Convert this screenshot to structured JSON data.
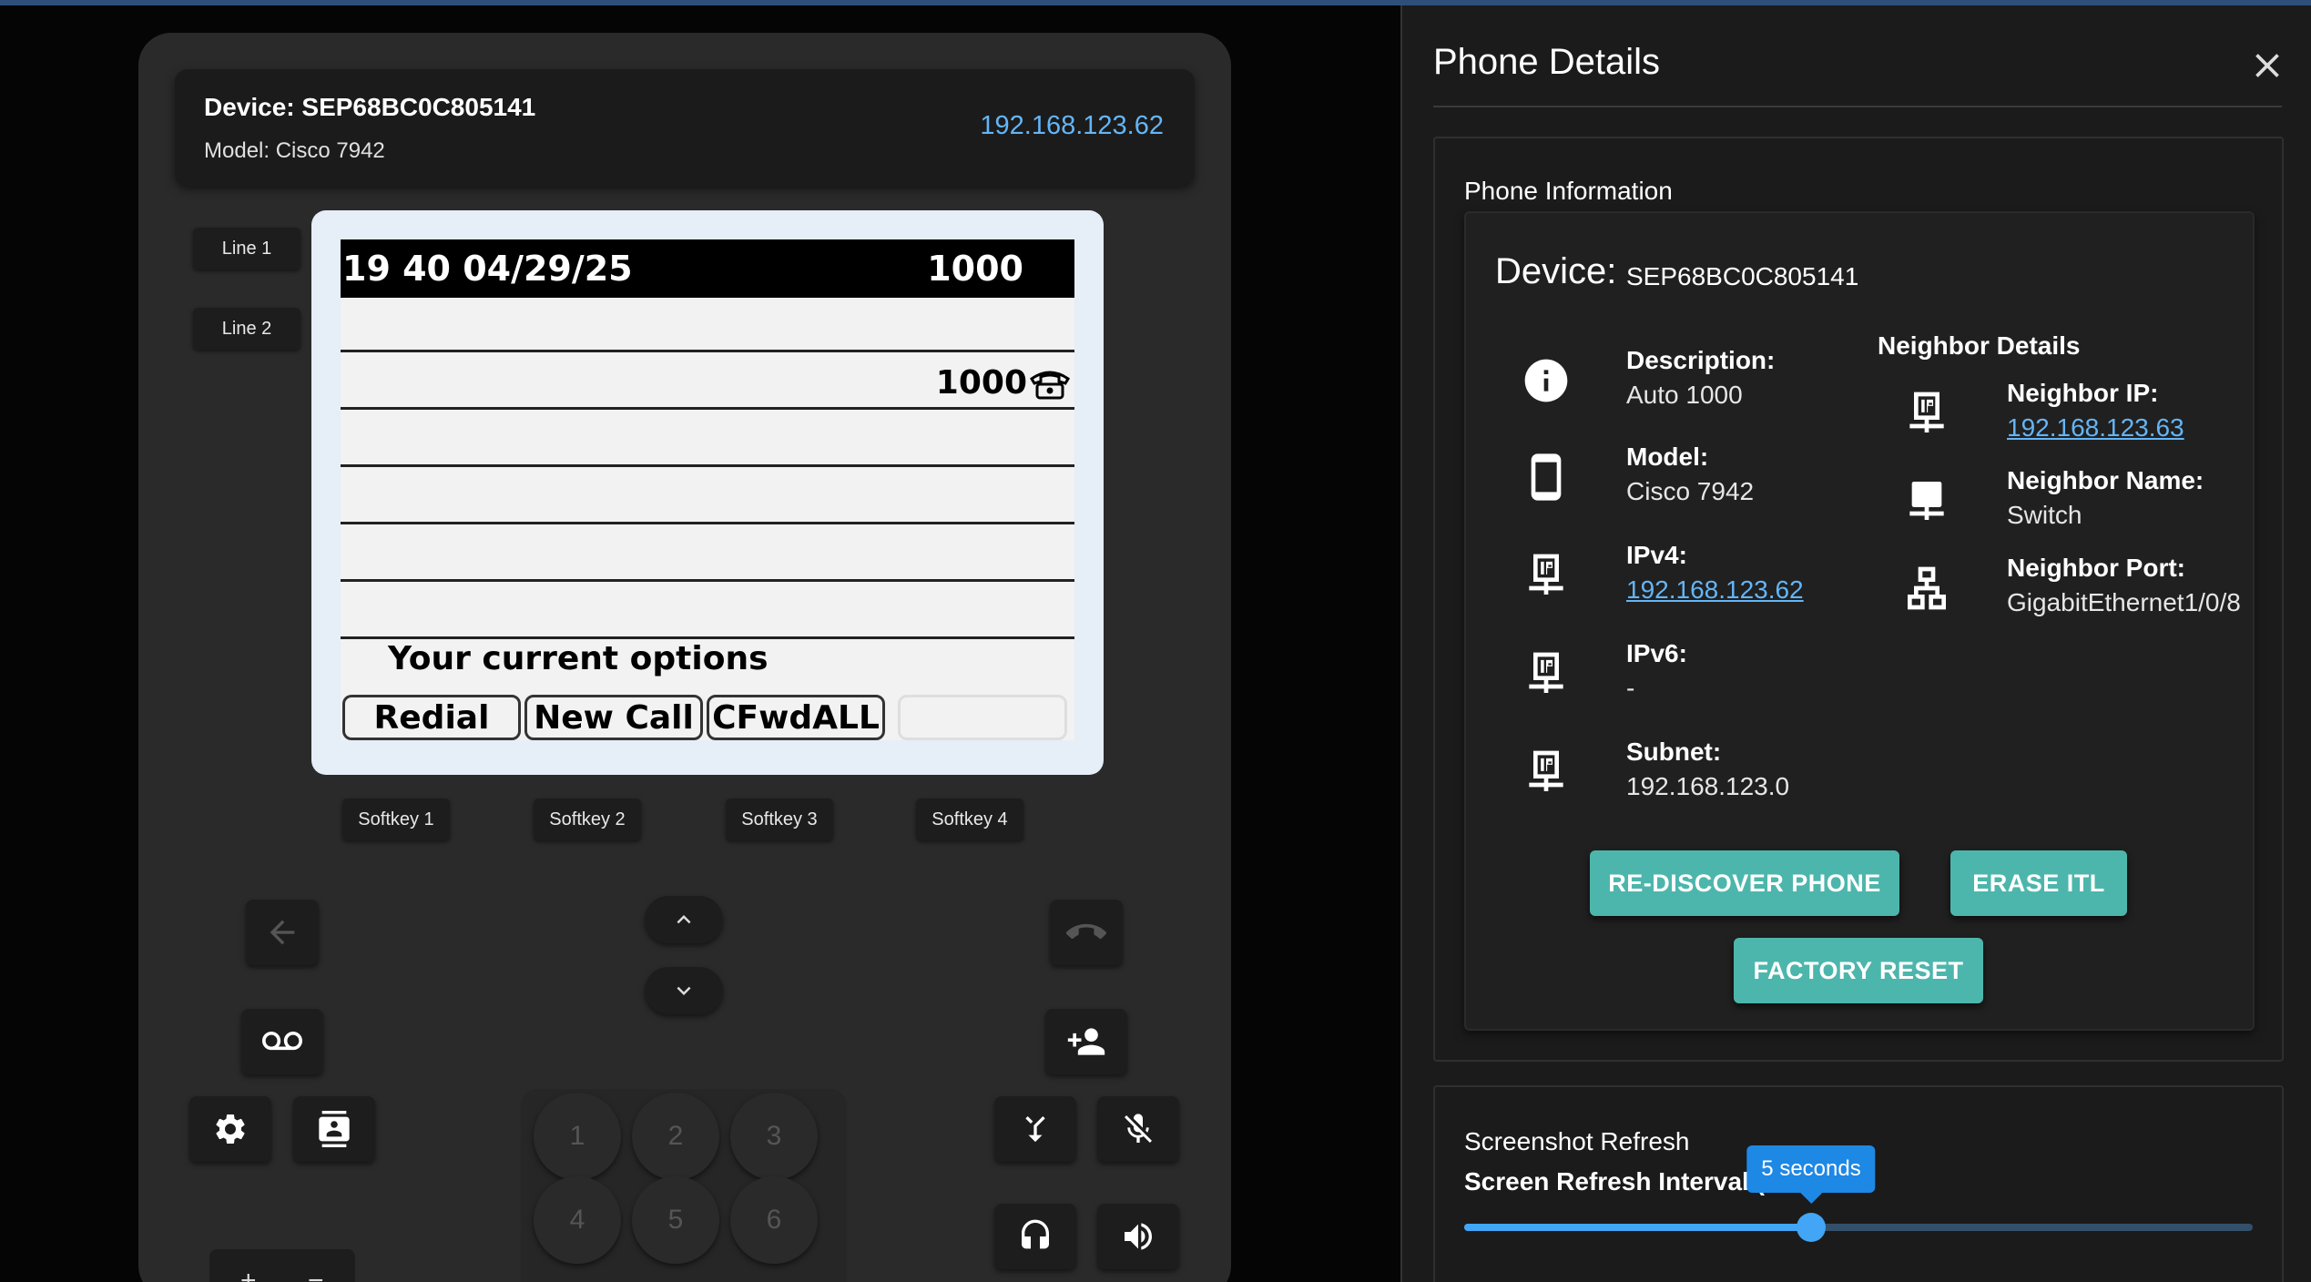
{
  "colors": {
    "accent": "#4db6ac",
    "link": "#64b5f6",
    "slider": "#42a5f5"
  },
  "device_header": {
    "title": "Device: SEP68BC0C805141",
    "model": "Model: Cisco 7942",
    "ip": "192.168.123.62"
  },
  "line_buttons": [
    "Line 1",
    "Line 2"
  ],
  "lcd": {
    "time": "19 40 04/29/25",
    "extension": "1000",
    "line1_number": "1000",
    "options_text": "Your current options",
    "softkeys": [
      "Redial",
      "New Call",
      "CFwdALL",
      ""
    ]
  },
  "softkey_buttons": [
    "Softkey 1",
    "Softkey 2",
    "Softkey 3",
    "Softkey 4"
  ],
  "keypad": [
    "1",
    "2",
    "3",
    "4",
    "5",
    "6"
  ],
  "volume": {
    "plus": "+",
    "minus": "−"
  },
  "icons": {
    "back": "arrow-left-icon",
    "up": "chevron-up-icon",
    "down": "chevron-down-icon",
    "hangup": "hang-up-icon",
    "voicemail": "voicemail-icon",
    "add_user": "person-add-icon",
    "settings": "gear-icon",
    "contacts": "contacts-icon",
    "transfer": "call-merge-icon",
    "mute": "mic-off-icon",
    "headset": "headset-icon",
    "speaker": "speaker-icon"
  },
  "panel": {
    "title": "Phone Details",
    "card_title": "Phone Information",
    "device_label": "Device:",
    "device_value": "SEP68BC0C805141",
    "fields": [
      {
        "label": "Description:",
        "value": "Auto 1000",
        "icon": "info-icon"
      },
      {
        "label": "Model:",
        "value": "Cisco 7942",
        "icon": "phone-device-icon"
      },
      {
        "label": "IPv4:",
        "value": "192.168.123.62",
        "icon": "ip-network-icon"
      },
      {
        "label": "IPv6:",
        "value": "-",
        "icon": "ip-network-icon"
      },
      {
        "label": "Subnet:",
        "value": "192.168.123.0",
        "icon": "ip-network-icon"
      }
    ],
    "neighbor_header": "Neighbor Details",
    "neighbor_fields": [
      {
        "label": "Neighbor IP:",
        "value": "192.168.123.63",
        "icon": "ip-network-icon"
      },
      {
        "label": "Neighbor Name:",
        "value": "Switch",
        "icon": "switch-icon"
      },
      {
        "label": "Neighbor Port:",
        "value": "GigabitEthernet1/0/8",
        "icon": "lan-icon"
      }
    ],
    "buttons": {
      "rediscover": "RE-DISCOVER PHONE",
      "erase_itl": "ERASE ITL",
      "factory_reset": "FACTORY RESET"
    },
    "refresh": {
      "title": "Screenshot Refresh",
      "interval_label": "Screen Refresh Interval (",
      "tooltip": "5 seconds",
      "value_fraction": 0.44
    }
  }
}
